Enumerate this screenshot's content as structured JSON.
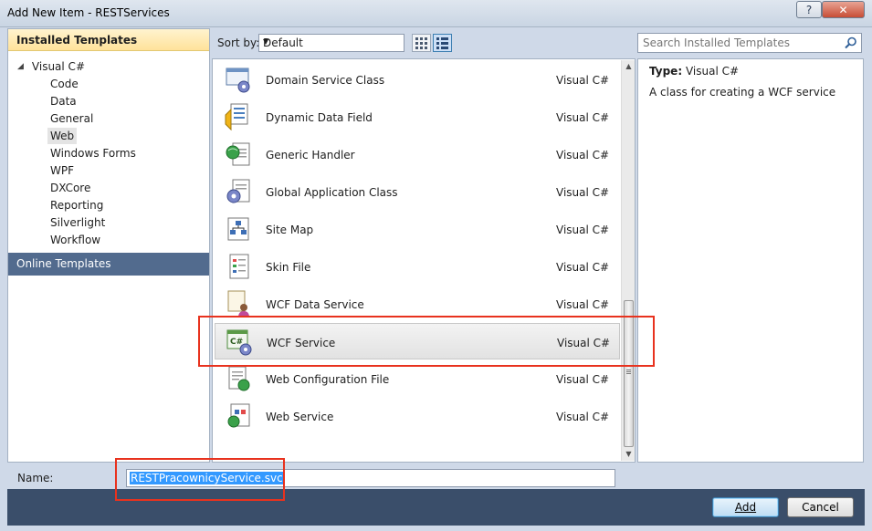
{
  "window": {
    "title": "Add New Item - RESTServices",
    "help_glyph": "?",
    "close_glyph": "✕"
  },
  "left": {
    "installed_header": "Installed Templates",
    "tree_root": "Visual C#",
    "tree_items": [
      "Code",
      "Data",
      "General",
      "Web",
      "Windows Forms",
      "WPF",
      "DXCore",
      "Reporting",
      "Silverlight",
      "Workflow"
    ],
    "selected_item": "Web",
    "online_header": "Online Templates"
  },
  "toolbar": {
    "sort_label": "Sort by:",
    "sort_value": "Default"
  },
  "templates": [
    {
      "name": "Domain Service Class",
      "lang": "Visual C#",
      "icon": "domain-service-icon"
    },
    {
      "name": "Dynamic Data Field",
      "lang": "Visual C#",
      "icon": "dynamic-data-icon"
    },
    {
      "name": "Generic Handler",
      "lang": "Visual C#",
      "icon": "generic-handler-icon"
    },
    {
      "name": "Global Application Class",
      "lang": "Visual C#",
      "icon": "global-app-icon"
    },
    {
      "name": "Site Map",
      "lang": "Visual C#",
      "icon": "site-map-icon"
    },
    {
      "name": "Skin File",
      "lang": "Visual C#",
      "icon": "skin-file-icon"
    },
    {
      "name": "WCF Data Service",
      "lang": "Visual C#",
      "icon": "wcf-data-service-icon"
    },
    {
      "name": "WCF Service",
      "lang": "Visual C#",
      "icon": "wcf-service-icon"
    },
    {
      "name": "Web Configuration File",
      "lang": "Visual C#",
      "icon": "web-config-icon"
    },
    {
      "name": "Web Service",
      "lang": "Visual C#",
      "icon": "web-service-icon"
    }
  ],
  "selected_template": "WCF Service",
  "search": {
    "placeholder": "Search Installed Templates"
  },
  "details": {
    "type_label": "Type:",
    "type_value": "Visual C#",
    "description": "A class for creating a WCF service"
  },
  "name_field": {
    "label": "Name:",
    "value": "RESTPracownicyService.svc"
  },
  "buttons": {
    "add": "Add",
    "cancel": "Cancel"
  },
  "colors": {
    "callout": "#e8321e",
    "accent": "#3c7fb1",
    "footer": "#3a4e6a",
    "online_header": "#526b8e"
  }
}
